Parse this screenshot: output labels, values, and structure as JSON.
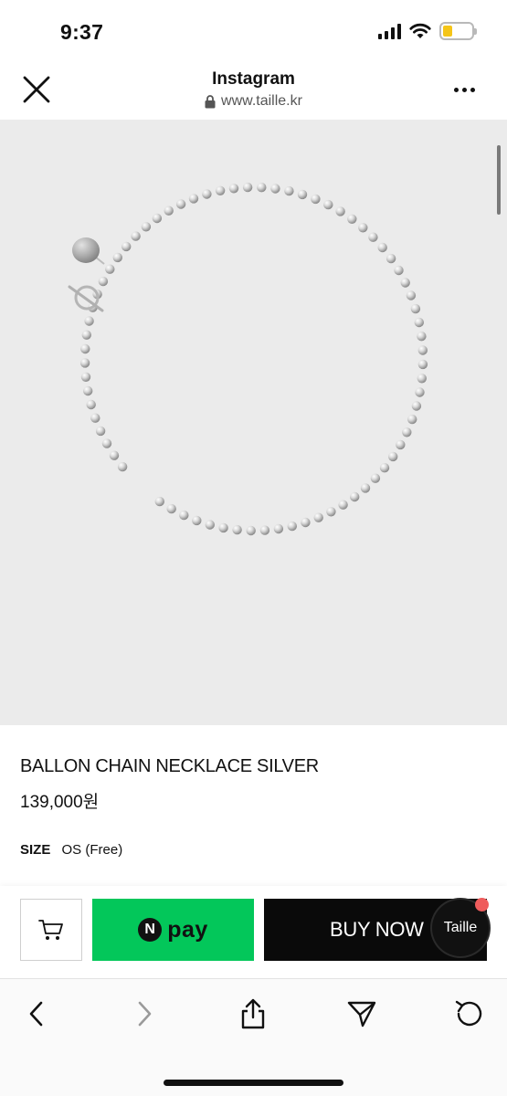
{
  "status_bar": {
    "time": "9:37",
    "icons": [
      "signal-icon",
      "wifi-icon",
      "battery-icon"
    ],
    "battery_color": "#f5c518"
  },
  "browser": {
    "title": "Instagram",
    "url": "www.taille.kr",
    "close_icon": "close-icon",
    "more_icon": "more-icon",
    "lock_icon": "lock-icon"
  },
  "product": {
    "name": "BALLON CHAIN NECKLACE SILVER",
    "price": "139,000원",
    "size_label": "SIZE",
    "size_value": "OS (Free)",
    "image_background": "#ebebeb"
  },
  "purchase_bar": {
    "cart_icon": "cart-icon",
    "npay_logo_letter": "N",
    "npay_label": "pay",
    "npay_color": "#03c75a",
    "buy_now_label": "BUY NOW",
    "buy_now_color": "#0a0a0a",
    "chat_badge_label": "Taille",
    "notification_color": "#ef5c5c"
  },
  "toolbar": {
    "icons": [
      "back-icon",
      "forward-icon",
      "share-icon",
      "send-icon",
      "reload-icon"
    ]
  }
}
